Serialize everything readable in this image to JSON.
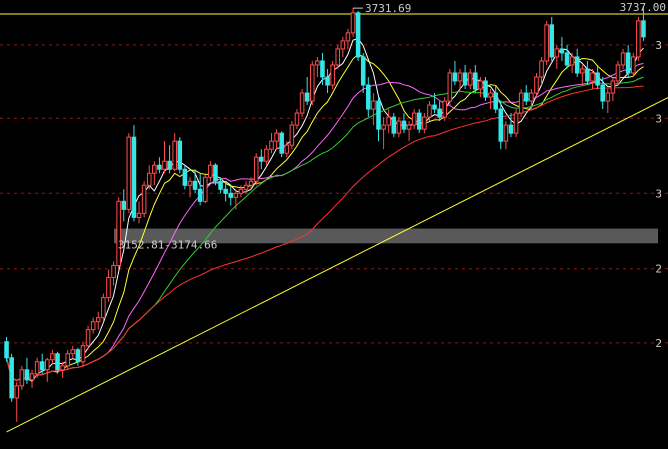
{
  "chart_data": {
    "type": "candlestick",
    "ylim": [
      2640,
      3737
    ],
    "grid": true,
    "grid_style": "dashed",
    "colors": {
      "background": "#000000",
      "up": "#ff4d4d",
      "down": "#35e6e6",
      "grid": "#8b1a1a",
      "ma5": "#ffffff",
      "ma10": "#ffff33",
      "ma20": "#ff66ff",
      "ma30": "#33cc33",
      "ma60": "#ff3333",
      "trendline": "#ffff33",
      "band": "#bbbbbb",
      "label_text": "#cccccc"
    },
    "y_ticks": [
      {
        "value": 3737,
        "label": "3737.00"
      },
      {
        "value": 3640,
        "label": "3"
      },
      {
        "value": 3457,
        "label": "3"
      },
      {
        "value": 3270,
        "label": "3"
      },
      {
        "value": 3082,
        "label": "2"
      },
      {
        "value": 2897,
        "label": "2"
      }
    ],
    "annotations": {
      "peak": {
        "label": "3731.69",
        "value": 3731.69,
        "index": 68
      },
      "band": {
        "label": "3152.81-3174.66",
        "low": 3152.81,
        "high": 3174.66
      }
    },
    "trendline": {
      "from": {
        "index": 0,
        "value": 2675
      },
      "to": {
        "index": 130,
        "value": 3520
      }
    },
    "ohlc": [
      [
        2900,
        2912,
        2850,
        2860
      ],
      [
        2860,
        2870,
        2750,
        2760
      ],
      [
        2760,
        2800,
        2700,
        2790
      ],
      [
        2790,
        2840,
        2780,
        2830
      ],
      [
        2830,
        2860,
        2795,
        2805
      ],
      [
        2805,
        2830,
        2785,
        2820
      ],
      [
        2820,
        2860,
        2810,
        2850
      ],
      [
        2850,
        2870,
        2820,
        2830
      ],
      [
        2830,
        2860,
        2800,
        2855
      ],
      [
        2855,
        2880,
        2845,
        2870
      ],
      [
        2870,
        2875,
        2820,
        2830
      ],
      [
        2830,
        2850,
        2810,
        2840
      ],
      [
        2840,
        2880,
        2830,
        2870
      ],
      [
        2870,
        2890,
        2860,
        2880
      ],
      [
        2880,
        2885,
        2840,
        2850
      ],
      [
        2850,
        2900,
        2840,
        2890
      ],
      [
        2890,
        2940,
        2880,
        2930
      ],
      [
        2930,
        2960,
        2920,
        2950
      ],
      [
        2950,
        2975,
        2930,
        2960
      ],
      [
        2960,
        3020,
        2950,
        3010
      ],
      [
        3010,
        3080,
        3000,
        3060
      ],
      [
        3060,
        3100,
        3040,
        3090
      ],
      [
        3090,
        3260,
        3080,
        3250
      ],
      [
        3250,
        3280,
        3200,
        3230
      ],
      [
        3230,
        3420,
        3220,
        3410
      ],
      [
        3410,
        3440,
        3200,
        3210
      ],
      [
        3210,
        3250,
        3195,
        3220
      ],
      [
        3220,
        3300,
        3210,
        3290
      ],
      [
        3290,
        3340,
        3280,
        3320
      ],
      [
        3320,
        3350,
        3290,
        3340
      ],
      [
        3340,
        3360,
        3320,
        3330
      ],
      [
        3330,
        3400,
        3320,
        3350
      ],
      [
        3350,
        3390,
        3320,
        3330
      ],
      [
        3330,
        3420,
        3325,
        3400
      ],
      [
        3400,
        3410,
        3320,
        3330
      ],
      [
        3330,
        3340,
        3280,
        3290
      ],
      [
        3290,
        3310,
        3260,
        3300
      ],
      [
        3300,
        3330,
        3270,
        3280
      ],
      [
        3280,
        3320,
        3240,
        3250
      ],
      [
        3250,
        3320,
        3245,
        3310
      ],
      [
        3310,
        3350,
        3300,
        3340
      ],
      [
        3340,
        3345,
        3290,
        3300
      ],
      [
        3300,
        3310,
        3270,
        3280
      ],
      [
        3280,
        3300,
        3250,
        3270
      ],
      [
        3270,
        3290,
        3240,
        3260
      ],
      [
        3260,
        3280,
        3230,
        3270
      ],
      [
        3270,
        3290,
        3260,
        3280
      ],
      [
        3280,
        3300,
        3270,
        3290
      ],
      [
        3290,
        3310,
        3280,
        3300
      ],
      [
        3300,
        3370,
        3290,
        3360
      ],
      [
        3360,
        3380,
        3330,
        3350
      ],
      [
        3350,
        3390,
        3340,
        3380
      ],
      [
        3380,
        3420,
        3370,
        3400
      ],
      [
        3400,
        3430,
        3380,
        3420
      ],
      [
        3420,
        3425,
        3360,
        3370
      ],
      [
        3370,
        3400,
        3360,
        3390
      ],
      [
        3390,
        3450,
        3380,
        3440
      ],
      [
        3440,
        3480,
        3430,
        3470
      ],
      [
        3470,
        3530,
        3460,
        3520
      ],
      [
        3520,
        3560,
        3490,
        3500
      ],
      [
        3500,
        3600,
        3490,
        3590
      ],
      [
        3590,
        3610,
        3560,
        3600
      ],
      [
        3600,
        3620,
        3540,
        3560
      ],
      [
        3560,
        3580,
        3520,
        3540
      ],
      [
        3540,
        3600,
        3530,
        3590
      ],
      [
        3590,
        3640,
        3580,
        3630
      ],
      [
        3630,
        3660,
        3610,
        3650
      ],
      [
        3650,
        3680,
        3630,
        3670
      ],
      [
        3670,
        3731.69,
        3660,
        3720
      ],
      [
        3720,
        3725,
        3600,
        3610
      ],
      [
        3610,
        3620,
        3520,
        3540
      ],
      [
        3540,
        3560,
        3460,
        3480
      ],
      [
        3480,
        3520,
        3440,
        3500
      ],
      [
        3500,
        3510,
        3400,
        3430
      ],
      [
        3430,
        3460,
        3380,
        3440
      ],
      [
        3440,
        3480,
        3420,
        3460
      ],
      [
        3460,
        3470,
        3410,
        3420
      ],
      [
        3420,
        3460,
        3410,
        3450
      ],
      [
        3450,
        3470,
        3420,
        3430
      ],
      [
        3430,
        3450,
        3400,
        3440
      ],
      [
        3440,
        3480,
        3430,
        3470
      ],
      [
        3470,
        3480,
        3420,
        3430
      ],
      [
        3430,
        3470,
        3420,
        3460
      ],
      [
        3460,
        3500,
        3450,
        3490
      ],
      [
        3490,
        3520,
        3470,
        3480
      ],
      [
        3480,
        3500,
        3450,
        3460
      ],
      [
        3460,
        3510,
        3450,
        3500
      ],
      [
        3500,
        3580,
        3490,
        3570
      ],
      [
        3570,
        3600,
        3540,
        3550
      ],
      [
        3550,
        3580,
        3530,
        3570
      ],
      [
        3570,
        3590,
        3530,
        3540
      ],
      [
        3540,
        3580,
        3530,
        3570
      ],
      [
        3570,
        3590,
        3520,
        3530
      ],
      [
        3530,
        3560,
        3510,
        3550
      ],
      [
        3550,
        3560,
        3500,
        3510
      ],
      [
        3510,
        3530,
        3480,
        3520
      ],
      [
        3520,
        3540,
        3470,
        3480
      ],
      [
        3480,
        3500,
        3380,
        3400
      ],
      [
        3400,
        3450,
        3380,
        3440
      ],
      [
        3440,
        3470,
        3410,
        3420
      ],
      [
        3420,
        3480,
        3410,
        3470
      ],
      [
        3470,
        3530,
        3460,
        3520
      ],
      [
        3520,
        3540,
        3490,
        3500
      ],
      [
        3500,
        3530,
        3480,
        3520
      ],
      [
        3520,
        3570,
        3510,
        3560
      ],
      [
        3560,
        3610,
        3540,
        3600
      ],
      [
        3600,
        3700,
        3590,
        3690
      ],
      [
        3690,
        3710,
        3600,
        3610
      ],
      [
        3610,
        3640,
        3580,
        3630
      ],
      [
        3630,
        3660,
        3600,
        3620
      ],
      [
        3620,
        3640,
        3580,
        3590
      ],
      [
        3590,
        3620,
        3570,
        3610
      ],
      [
        3610,
        3630,
        3560,
        3570
      ],
      [
        3570,
        3590,
        3540,
        3580
      ],
      [
        3580,
        3600,
        3540,
        3550
      ],
      [
        3550,
        3580,
        3530,
        3570
      ],
      [
        3570,
        3590,
        3530,
        3540
      ],
      [
        3540,
        3560,
        3480,
        3500
      ],
      [
        3500,
        3530,
        3470,
        3520
      ],
      [
        3520,
        3560,
        3500,
        3550
      ],
      [
        3550,
        3600,
        3540,
        3590
      ],
      [
        3590,
        3630,
        3580,
        3620
      ],
      [
        3620,
        3640,
        3560,
        3570
      ],
      [
        3570,
        3620,
        3560,
        3610
      ],
      [
        3610,
        3710,
        3600,
        3700
      ],
      [
        3700,
        3737,
        3650,
        3660
      ]
    ]
  }
}
